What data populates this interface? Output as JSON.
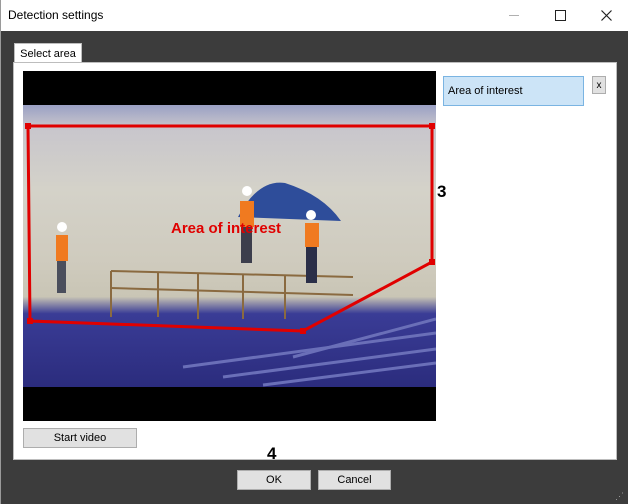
{
  "window": {
    "title": "Detection settings"
  },
  "tabs": [
    {
      "label": "Select area"
    }
  ],
  "video": {
    "area_label": "Area of interest",
    "start_button": "Start video"
  },
  "area_list": {
    "selected_item": "Area of interest",
    "remove_label": "x"
  },
  "callouts": {
    "area": "3",
    "ok": "4"
  },
  "footer": {
    "ok_label": "OK",
    "cancel_label": "Cancel"
  },
  "colors": {
    "area_outline": "#e00000",
    "selection_fill": "#cce4f7",
    "window_background": "#3c3c3c"
  }
}
